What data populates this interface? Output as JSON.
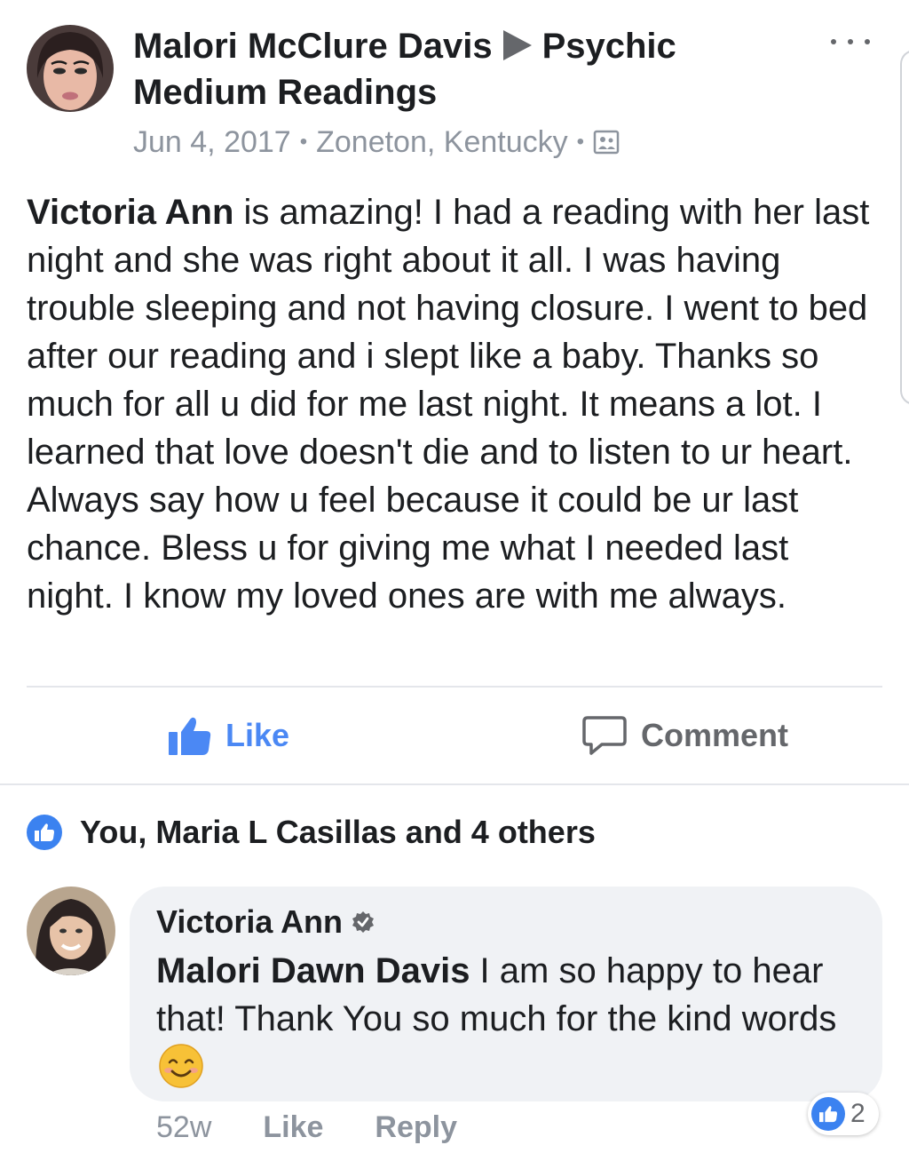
{
  "post": {
    "author": "Malori McClure Davis",
    "target": "Psychic Medium Readings",
    "date": "Jun 4, 2017",
    "location": "Zoneton, Kentucky",
    "separator": "•",
    "audience_icon": "custom-audience-icon",
    "body_tag": "Victoria Ann",
    "body_text": " is amazing! I had a reading with her last night and she was right about it all. I was having trouble sleeping and not having closure. I went to bed after our reading and i slept like a baby. Thanks so much for all u did for me last night. It means a lot. I learned that love doesn't die and to listen to ur heart. Always say how u feel because it could be ur last chance.  Bless u for giving me what I needed last night. I know my loved ones are with me always."
  },
  "actions": {
    "like_label": "Like",
    "comment_label": "Comment"
  },
  "reactions": {
    "summary": "You, Maria L Casillas and 4 others"
  },
  "comment": {
    "author": "Victoria Ann",
    "mention": "Malori Dawn Davis",
    "text": " I am so happy to hear that! Thank You so much for the kind words",
    "time": "52w",
    "like_label": "Like",
    "reply_label": "Reply",
    "reaction_count": "2"
  },
  "colors": {
    "accent": "#4b88f4",
    "like_bubble": "#3b82f0",
    "muted_text": "#8d949e",
    "bubble_bg": "#f0f2f5"
  }
}
